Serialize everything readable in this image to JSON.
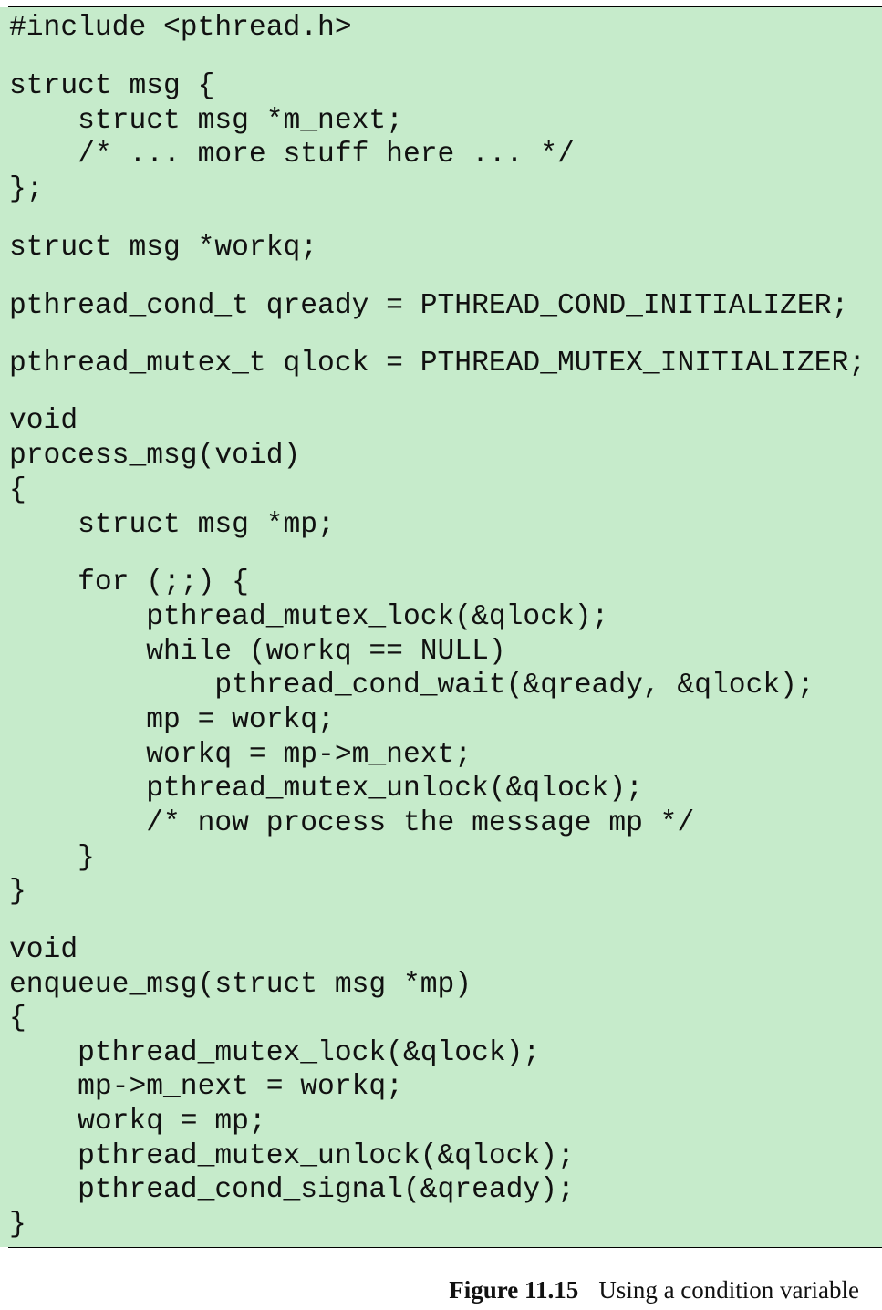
{
  "code": {
    "lines": [
      "#include <pthread.h>",
      "struct msg {",
      "    struct msg *m_next;",
      "    /* ... more stuff here ... */",
      "};",
      "struct msg *workq;",
      "pthread_cond_t qready = PTHREAD_COND_INITIALIZER;",
      "pthread_mutex_t qlock = PTHREAD_MUTEX_INITIALIZER;",
      "void",
      "process_msg(void)",
      "{",
      "    struct msg *mp;",
      "    for (;;) {",
      "        pthread_mutex_lock(&qlock);",
      "        while (workq == NULL)",
      "            pthread_cond_wait(&qready, &qlock);",
      "        mp = workq;",
      "        workq = mp->m_next;",
      "        pthread_mutex_unlock(&qlock);",
      "        /* now process the message mp */",
      "    }",
      "}",
      "void",
      "enqueue_msg(struct msg *mp)",
      "{",
      "    pthread_mutex_lock(&qlock);",
      "    mp->m_next = workq;",
      "    workq = mp;",
      "    pthread_mutex_unlock(&qlock);",
      "    pthread_cond_signal(&qready);",
      "}"
    ]
  },
  "caption": {
    "label": "Figure 11.15",
    "text": "Using a condition variable"
  }
}
